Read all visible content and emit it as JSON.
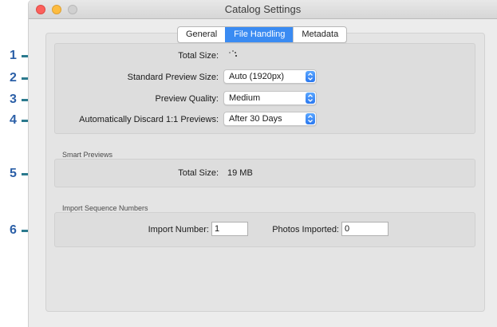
{
  "window": {
    "title": "Catalog Settings"
  },
  "tabs": [
    {
      "label": "General",
      "active": false
    },
    {
      "label": "File Handling",
      "active": true
    },
    {
      "label": "Metadata",
      "active": false
    }
  ],
  "preview_cache": {
    "total_size_label": "Total Size:",
    "standard_preview_size_label": "Standard Preview Size:",
    "standard_preview_size_value": "Auto (1920px)",
    "preview_quality_label": "Preview Quality:",
    "preview_quality_value": "Medium",
    "discard_label": "Automatically Discard 1:1 Previews:",
    "discard_value": "After 30 Days"
  },
  "smart_previews": {
    "section_title": "Smart Previews",
    "total_size_label": "Total Size:",
    "total_size_value": "19 MB"
  },
  "import_sequence": {
    "section_title": "Import Sequence Numbers",
    "import_number_label": "Import Number:",
    "import_number_value": "1",
    "photos_imported_label": "Photos Imported:",
    "photos_imported_value": "0"
  },
  "callouts": [
    "1",
    "2",
    "3",
    "4",
    "5",
    "6"
  ],
  "colors": {
    "callout_text": "#2b5fa7",
    "callout_line": "#2b7a8e",
    "active_tab": "#3a8bf2"
  }
}
